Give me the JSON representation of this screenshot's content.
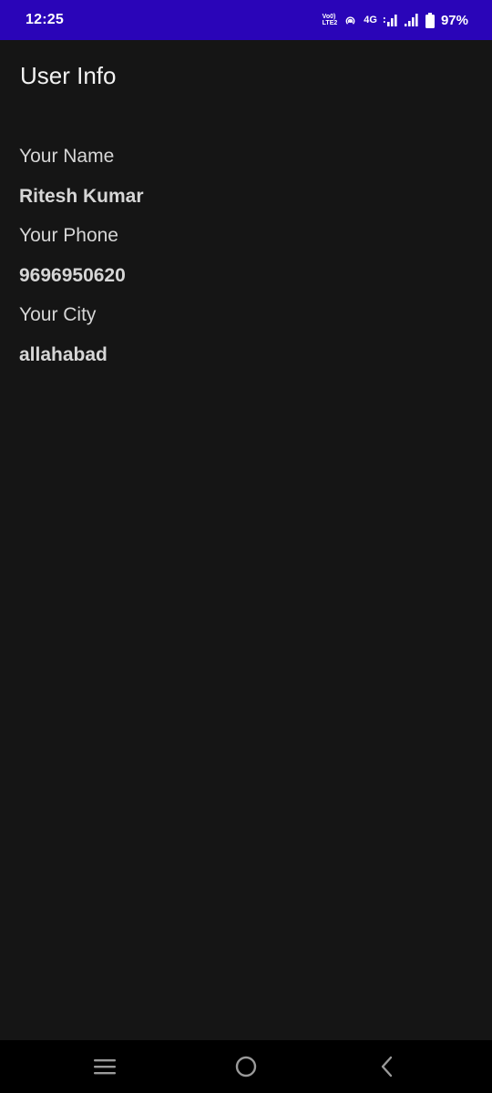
{
  "status_bar": {
    "time": "12:25",
    "volte_top": "Vo0)",
    "volte_bottom": "LTE2",
    "network_type": "4G",
    "battery_percent": "97%",
    "battery_level": 0.97,
    "icons": [
      "volte-icon",
      "hotspot-icon",
      "signal-icon",
      "signal-icon",
      "battery-icon"
    ]
  },
  "header": {
    "title": "User Info"
  },
  "user_info": {
    "name_label": "Your Name",
    "name_value": "Ritesh Kumar",
    "phone_label": "Your Phone",
    "phone_value": "9696950620",
    "city_label": "Your City",
    "city_value": "allahabad"
  },
  "nav_bar": {
    "icons": [
      "recents-icon",
      "home-icon",
      "back-icon"
    ]
  },
  "colors": {
    "status_bar_bg": "#2a05b8",
    "page_bg": "#151515",
    "nav_bar_bg": "#000000",
    "text": "#d6d6d6"
  }
}
